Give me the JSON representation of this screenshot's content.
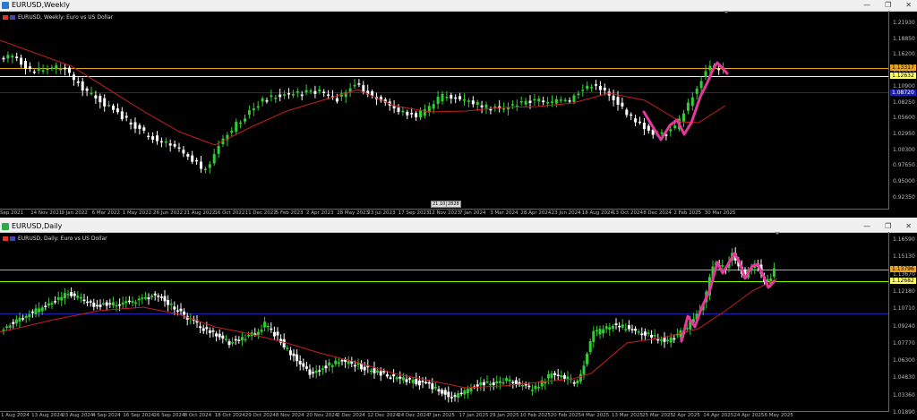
{
  "weekly": {
    "window_title": "EURUSD,Weekly",
    "symbol_label": "EURUSD, Weekly:  Euro vs US Dollar",
    "y_labels": [
      "1.21930",
      "1.18850",
      "1.16200",
      "1.13550",
      "1.10900",
      "1.08250",
      "1.05600",
      "1.02950",
      "1.00300",
      "0.97650",
      "0.95000",
      "0.92350"
    ],
    "price_tag_orange": "1.13317",
    "price_tag_yellow": "1.12632",
    "price_tag_blue": "1.08720",
    "cursor_tag_1": "21.10.20",
    "cursor_tag_2": "2828",
    "x_labels": [
      "Sep 2021",
      "14 Nov 2021",
      "9 Jan 2022",
      "6 Mar 2022",
      "1 May 2022",
      "26 Jun 2022",
      "21 Aug 2022",
      "16 Oct 2022",
      "11 Dec 2022",
      "5 Feb 2023",
      "2 Apr 2023",
      "28 May 2023",
      "23 Jul 2023",
      "17 Sep 2023",
      "12 Nov 2023",
      "7 Jan 2024",
      "3 Mar 2024",
      "28 Apr 2024",
      "23 Jun 2024",
      "18 Aug 2024",
      "13 Oct 2024",
      "8 Dec 2024",
      "2 Feb 2025",
      "30 Mar 2025"
    ]
  },
  "daily": {
    "window_title": "EURUSD,Daily",
    "symbol_label": "EURUSD, Daily:  Euro vs US Dollar",
    "y_labels": [
      "1.16590",
      "1.15130",
      "1.13670",
      "1.12180",
      "1.10710",
      "1.09240",
      "1.07770",
      "1.06300",
      "1.04830",
      "1.03360",
      "1.01890"
    ],
    "price_tag_orange": "1.13796",
    "price_tag_yellow": "1.12682",
    "x_labels": [
      "1 Aug 2024",
      "13 Aug 2024",
      "23 Aug 2024",
      "4 Sep 2024",
      "16 Sep 2024",
      "26 Sep 2024",
      "8 Oct 2024",
      "18 Oct 2024",
      "29 Oct 2024",
      "8 Nov 2024",
      "20 Nov 2024",
      "2 Dec 2024",
      "12 Dec 2024",
      "24 Dec 2024",
      "7 Jan 2025",
      "17 Jan 2025",
      "29 Jan 2025",
      "10 Feb 2025",
      "20 Feb 2025",
      "4 Mar 2025",
      "13 Mar 2025",
      "25 Mar 2025",
      "2 Apr 2025",
      "14 Apr 2025",
      "24 Apr 2025",
      "6 May 2025"
    ]
  },
  "colors": {
    "bull": "#32cd32",
    "bear": "#ffffff",
    "ma": "#c81e1e",
    "drawing": "#e6389c",
    "orange_line": "#e8a323",
    "yellow_line": "#ffff66",
    "blue_line": "#2020b0"
  }
}
